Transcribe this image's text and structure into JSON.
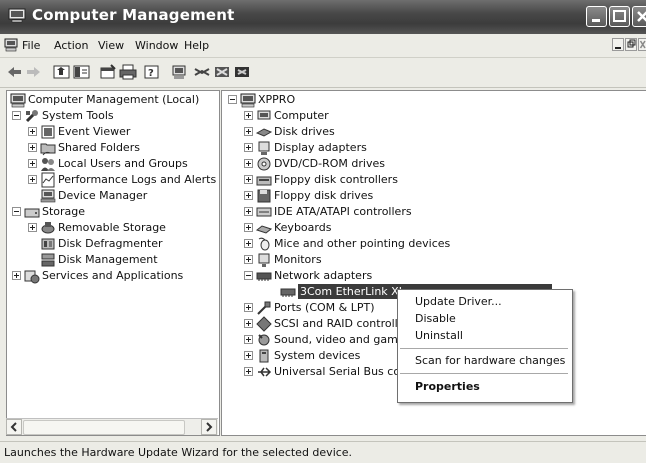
{
  "window": {
    "title": "Computer Management"
  },
  "menu": [
    "File",
    "Action",
    "View",
    "Window",
    "Help"
  ],
  "left_tree": {
    "root": "Computer Management (Local)",
    "system_tools": "System Tools",
    "event_viewer": "Event Viewer",
    "shared_folders": "Shared Folders",
    "local_users": "Local Users and Groups",
    "perf_logs": "Performance Logs and Alerts",
    "device_manager": "Device Manager",
    "storage": "Storage",
    "removable_storage": "Removable Storage",
    "disk_defrag": "Disk Defragmenter",
    "disk_mgmt": "Disk Management",
    "services": "Services and Applications"
  },
  "right_tree": {
    "root": "XPPRO",
    "items": [
      "Computer",
      "Disk drives",
      "Display adapters",
      "DVD/CD-ROM drives",
      "Floppy disk controllers",
      "Floppy disk drives",
      "IDE ATA/ATAPI controllers",
      "Keyboards",
      "Mice and other pointing devices",
      "Monitors",
      "Network adapters"
    ],
    "network_child": "3Com EtherLink XL",
    "items_after": [
      "Ports (COM & LPT)",
      "SCSI and RAID controll",
      "Sound, video and game",
      "System devices",
      "Universal Serial Bus cor"
    ]
  },
  "context_menu": {
    "update_driver": "Update Driver...",
    "disable": "Disable",
    "uninstall": "Uninstall",
    "scan": "Scan for hardware changes",
    "properties": "Properties"
  },
  "status": {
    "text": "Launches the Hardware Update Wizard for the selected device."
  }
}
